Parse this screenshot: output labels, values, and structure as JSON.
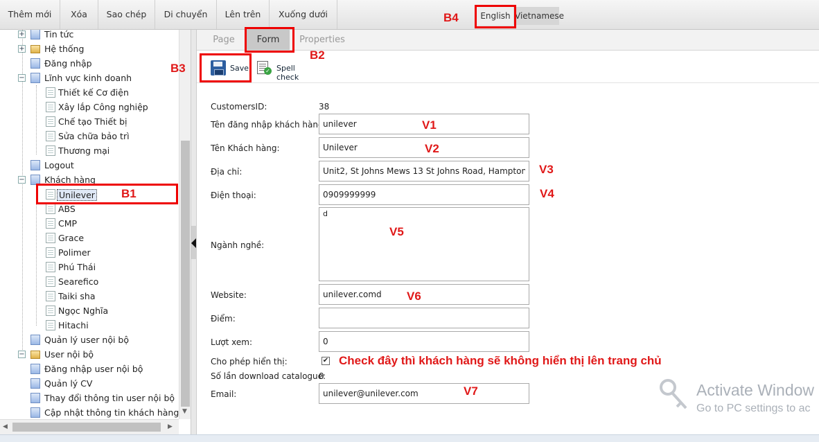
{
  "toolbar": {
    "buttons": [
      "Thêm mới",
      "Xóa",
      "Sao chép",
      "Di chuyển",
      "Lên trên",
      "Xuống dưới"
    ],
    "languages": [
      "English",
      "Vietnamese"
    ]
  },
  "tree": {
    "items": [
      "Tin tức",
      "Hệ thống",
      "Đăng nhập",
      "Lĩnh vực kinh doanh",
      "Thiết kế Cơ điện",
      "Xây lắp Công nghiệp",
      "Chế tạo Thiết bị",
      "Sửa chữa bảo trì",
      "Thương mại",
      "Logout",
      "Khách hàng",
      "Unilever",
      "ABS",
      "CMP",
      "Grace",
      "Polimer",
      "Phú Thái",
      "Searefico",
      "Taiki sha",
      "Ngọc Nghĩa",
      "Hitachi",
      "Quản lý user nội bộ",
      "User nội bộ",
      "Đăng nhập user nội bộ",
      "Quản lý CV",
      "Thay đổi thông tin user nội bộ",
      "Cập nhật thông tin khách hàng"
    ],
    "selected": "Unilever"
  },
  "tabs": [
    "Page",
    "Form",
    "Properties"
  ],
  "active_tab": "Form",
  "actions": {
    "save": "Save",
    "spell_check": "Spell check"
  },
  "form": {
    "customers_id_label": "CustomersID:",
    "customers_id_value": "38",
    "username_label": "Tên đăng nhập khách hàng:",
    "username_value": "unilever",
    "name_label": "Tên Khách hàng:",
    "name_value": "Unilever",
    "address_label": "Địa chỉ:",
    "address_value": "Unit2, St Johns Mews 13 St Johns Road, Hampton",
    "phone_label": "Điện thoại:",
    "phone_value": "0909999999",
    "industry_label": "Ngành nghề:",
    "industry_value": "d",
    "website_label": "Website:",
    "website_value": "unilever.comd",
    "score_label": "Điểm:",
    "score_value": "",
    "views_label": "Lượt xem:",
    "views_value": "0",
    "visible_label": "Cho phép hiển thị:",
    "visible_checked": true,
    "downloads_label": "Số lần download catalogue:",
    "downloads_value": "0",
    "email_label": "Email:",
    "email_value": "unilever@unilever.com"
  },
  "annotations": {
    "B1": "B1",
    "B2": "B2",
    "B3": "B3",
    "B4": "B4",
    "V1": "V1",
    "V2": "V2",
    "V3": "V3",
    "V4": "V4",
    "V5": "V5",
    "V6": "V6",
    "V7": "V7",
    "note": "Check đây thì khách hàng sẽ không hiển thị lên trang chủ",
    "annotation_color": "#e01818"
  },
  "watermark": {
    "line1": "Activate Window",
    "line2": "Go to PC settings to ac"
  }
}
